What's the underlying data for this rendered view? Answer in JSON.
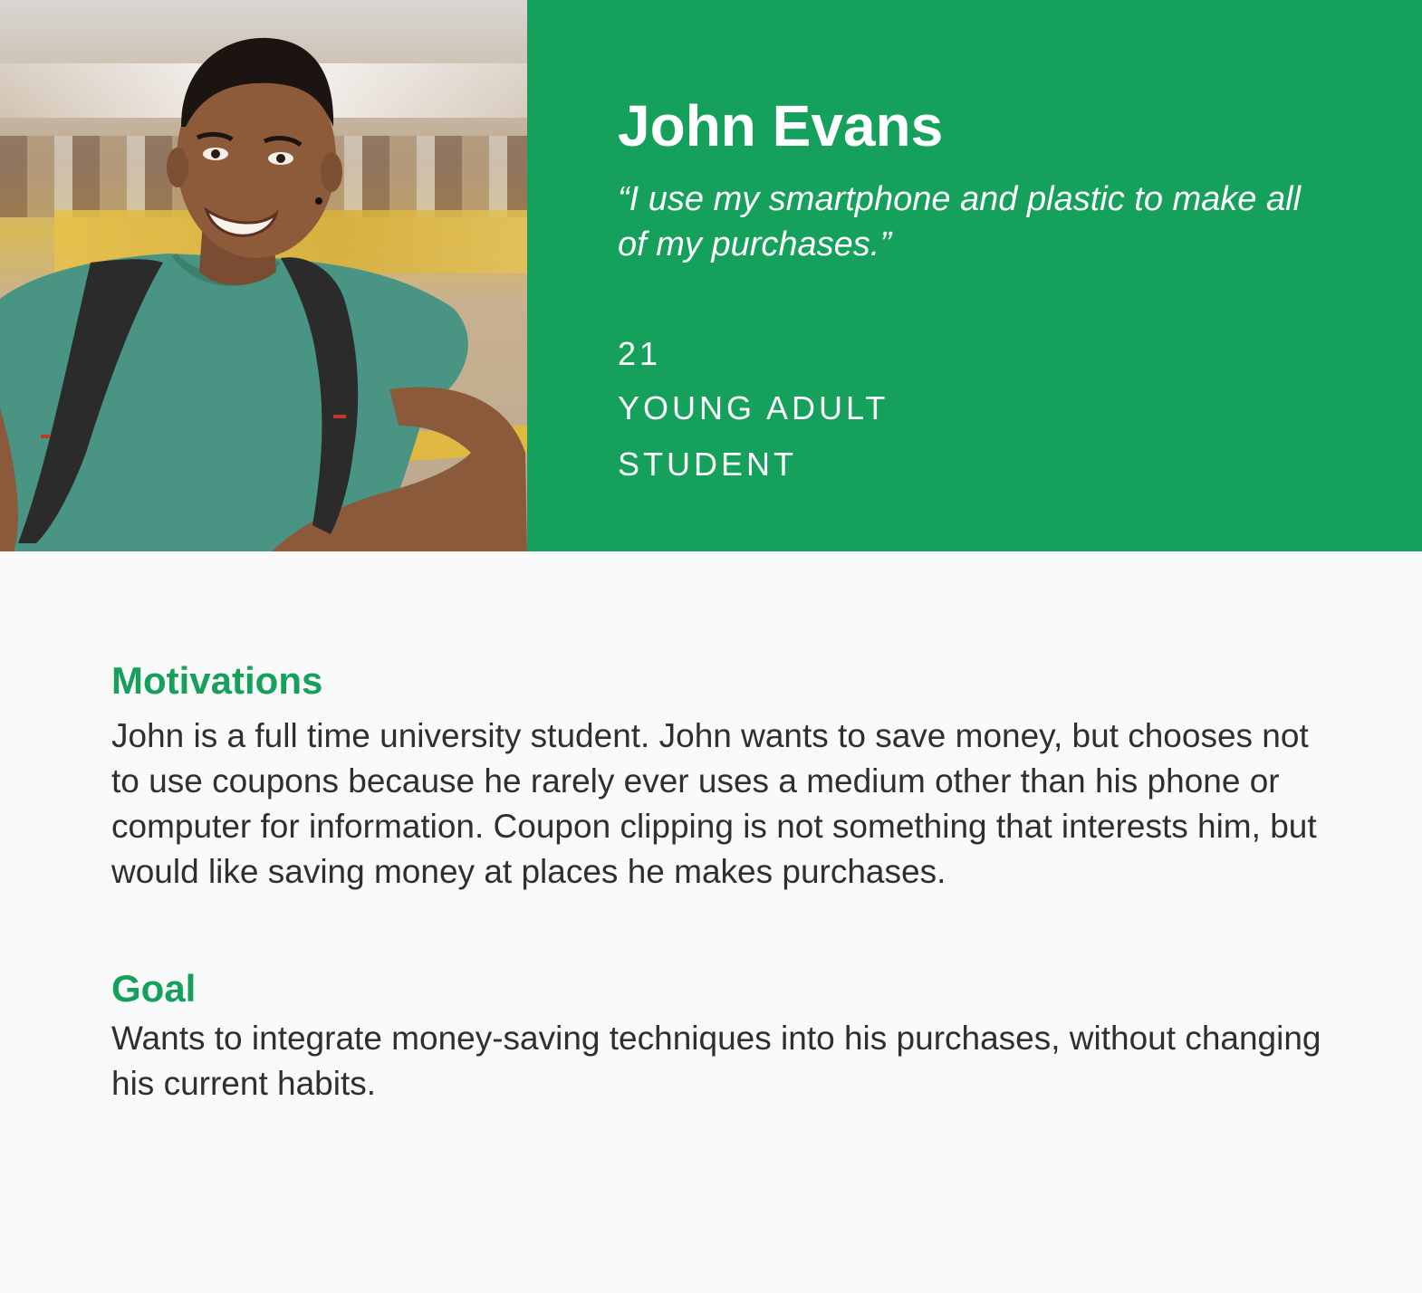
{
  "persona": {
    "name": "John Evans",
    "quote": "“I use my smartphone and plastic to make all of my purchases.”",
    "age": "21",
    "life_stage": "YOUNG ADULT",
    "occupation": "STUDENT"
  },
  "sections": {
    "motivations": {
      "title": "Motivations",
      "body": "John is a full time university student. John wants to save money, but chooses not to use coupons because he rarely ever uses a medium other than his phone or computer for information. Coupon clipping is not something that interests him, but would like saving money at places he makes purchases."
    },
    "goal": {
      "title": "Goal",
      "body": "Wants to integrate money-saving techniques into his purchases, without changing his current habits."
    }
  },
  "colors": {
    "accent": "#15a05b",
    "background": "#fafafa",
    "body_text": "#2f2f2f"
  }
}
